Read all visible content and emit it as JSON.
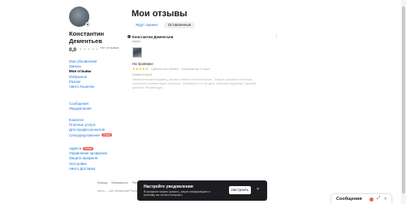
{
  "user": {
    "name": "Константин Дементьев",
    "rating": "0,0",
    "stars": "★★★★★",
    "no_reviews": "Нет отзывов"
  },
  "nav": {
    "group1": [
      "Мои объявления",
      "Заказы",
      "Мои отзывы",
      "Избранное",
      "Разное",
      "Авито Кошелек"
    ],
    "group2": [
      "Сообщения",
      "Уведомления"
    ],
    "group3": [
      "Кошелек",
      "Платные услуги",
      "Для профессионалов",
      "Спецпредложения"
    ],
    "group4": [
      "Адреса",
      "Управление профилем",
      "Защита профиля",
      "Настройки",
      "Авито Доставка"
    ],
    "badge_new": "Новое"
  },
  "main": {
    "title": "Мои отзывы",
    "tabs": [
      "Ждут оценки",
      "Оставленные"
    ]
  },
  "review": {
    "author": "Константин Дементьев",
    "date": "вчера",
    "menu": "⋮",
    "status": "На проверке",
    "stars": "★★★★★",
    "deal": "Сделка состоялась · Конструктор «Lego»",
    "comment_label": "Комментарий",
    "text": "Замечательный продавец, быстро ответил на все вопросы. Товар в хорошем состоянии, полностью соответствует описанию. Отправил в тот же день, упаковка надёжная. Сделкой доволен. Рекомендую."
  },
  "footer": {
    "links": [
      "Помощь",
      "Безопасность",
      "Реклама на сайте",
      "О компании",
      "Вакансии",
      "Мобильное приложение"
    ],
    "copy": "Авито — сайт объявлений России. © ООО «КЕХ еКоммерц» 2007–2024."
  },
  "notification": {
    "title": "Настройте уведомления",
    "text": "В профиле можно указать, какую информацию и рекламу вы хотите получать",
    "button": "Настроить",
    "close": "×"
  },
  "messages": {
    "label": "Сообщения",
    "expand": "⤢",
    "close": "×"
  },
  "colors": {
    "link": "#1a7ae0",
    "badge": "#f35a5a",
    "star": "#f2b400",
    "notification_bg": "#1c1d20"
  }
}
